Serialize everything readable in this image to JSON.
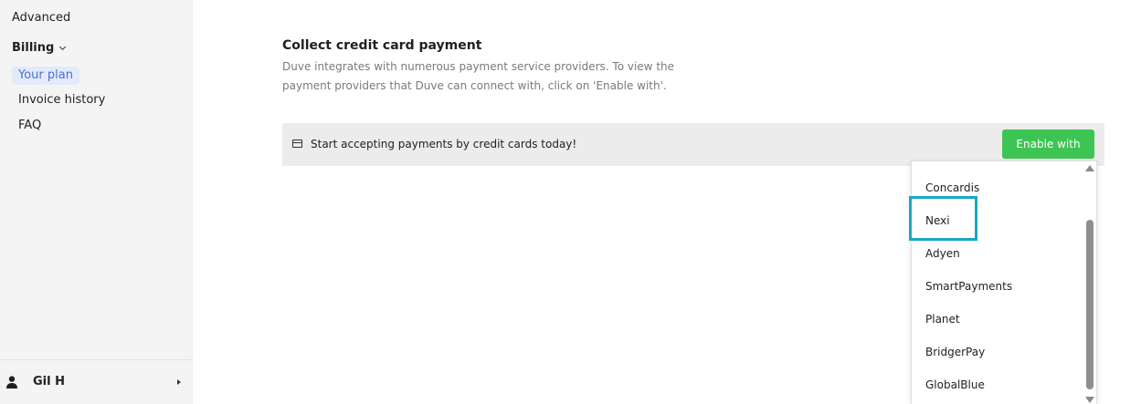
{
  "sidebar": {
    "advanced_label": "Advanced",
    "billing_label": "Billing",
    "billing_items": [
      {
        "label": "Your plan",
        "active": true
      },
      {
        "label": "Invoice history",
        "active": false
      },
      {
        "label": "FAQ",
        "active": false
      }
    ],
    "user": {
      "name": "Gil H"
    }
  },
  "main": {
    "title": "Collect credit card payment",
    "description": "Duve integrates with numerous payment service providers. To view the payment providers that Duve can connect with, click on 'Enable with'.",
    "banner": {
      "icon": "credit-card-icon",
      "text": "Start accepting payments by credit cards today!",
      "button_label": "Enable with"
    },
    "dropdown": {
      "options": [
        "Concardis",
        "Nexi",
        "Adyen",
        "SmartPayments",
        "Planet",
        "BridgerPay",
        "GlobalBlue"
      ],
      "highlighted": "Nexi"
    }
  },
  "colors": {
    "accent_green": "#3ec453",
    "active_bg": "#e2eafb",
    "active_text": "#4a6fd4",
    "highlight_border": "#1aa6c9",
    "sidebar_bg": "#f4f4f4",
    "banner_bg": "#ececec"
  }
}
